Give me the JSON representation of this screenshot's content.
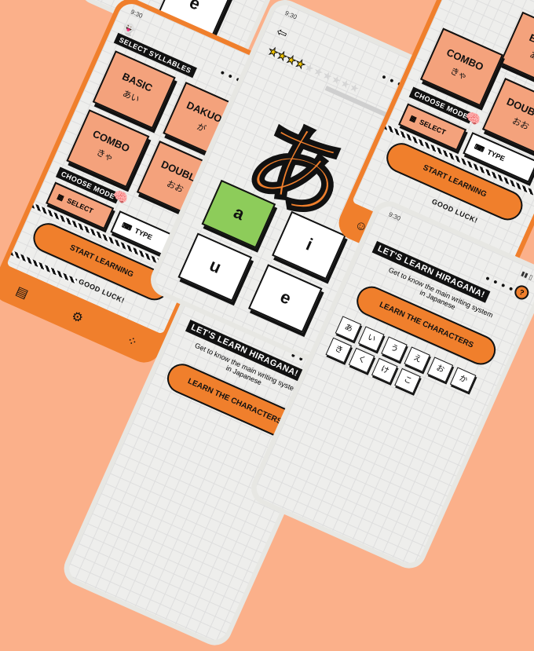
{
  "status_time": "9:30",
  "select_syllables": "SELECT SYLLABLES",
  "choose_mode": "CHOOSE MODE",
  "cards": {
    "basic": {
      "title": "BASIC",
      "kana": "あい"
    },
    "dakuon": {
      "title": "DAKUON",
      "kana": "が"
    },
    "combo": {
      "title": "COMBO",
      "kana": "きゃ"
    },
    "double": {
      "title": "DOUBLE",
      "kana": "おお"
    }
  },
  "modes": {
    "select": "SELECT",
    "type": "TYPE"
  },
  "start_learning": "START LEARNING",
  "good_luck": "GOOD LUCK!",
  "quiz": {
    "kana": "あ",
    "answers": [
      "a",
      "i",
      "u",
      "e"
    ],
    "stars_filled": 4,
    "stars_total": 10
  },
  "learn": {
    "title": "LET'S LEARN HIRAGANA!",
    "subtitle": "Get to know the main writing system in Japanese",
    "button": "LEARN THE CHARACTERS",
    "chars": [
      "あ",
      "い",
      "う",
      "え",
      "お",
      "か",
      "き",
      "く",
      "け",
      "こ"
    ]
  },
  "peek_answer": "e",
  "help_symbol": "?",
  "back_arrow": "⇦",
  "colors": {
    "accent": "#f07f2c",
    "card": "#f4a27c",
    "correct": "#8dcc5a",
    "background": "#fbb08a"
  }
}
